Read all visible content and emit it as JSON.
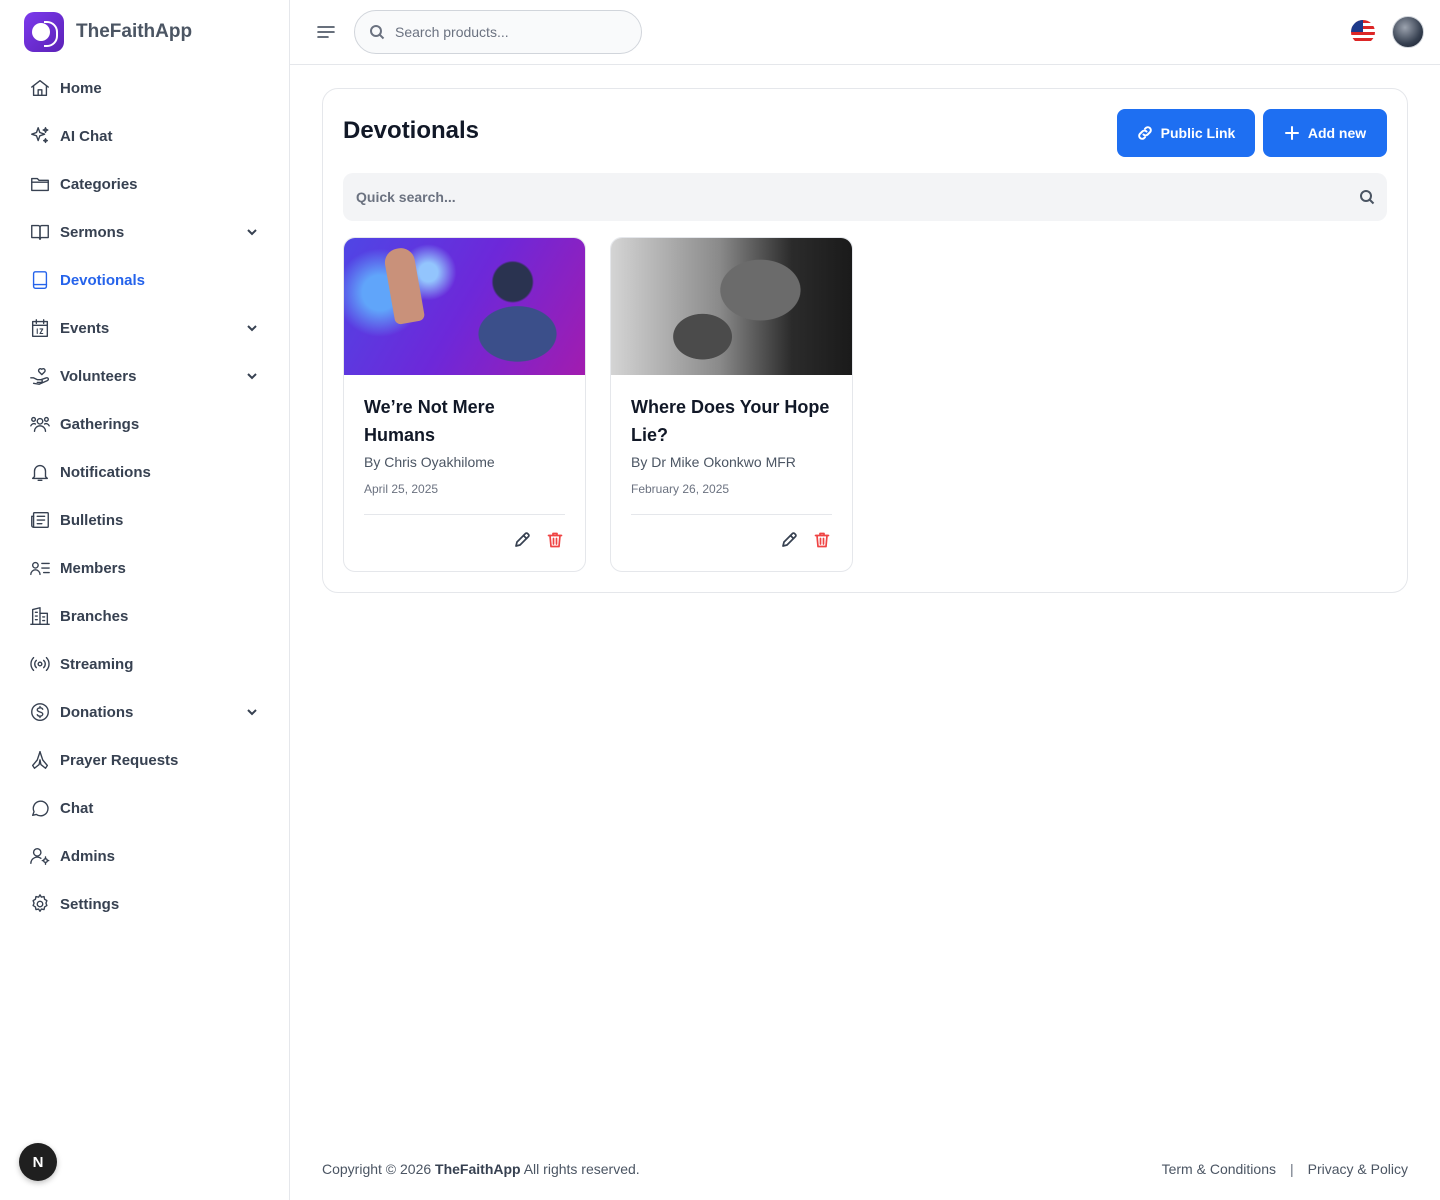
{
  "brand": {
    "name": "TheFaithApp"
  },
  "sidebar": {
    "items": [
      {
        "label": "Home",
        "icon": "home-icon",
        "has_chevron": false
      },
      {
        "label": "AI Chat",
        "icon": "sparkle-icon",
        "has_chevron": false
      },
      {
        "label": "Categories",
        "icon": "folder-icon",
        "has_chevron": false
      },
      {
        "label": "Sermons",
        "icon": "book-icon",
        "has_chevron": true
      },
      {
        "label": "Devotionals",
        "icon": "devotional-book-icon",
        "has_chevron": false,
        "active": true
      },
      {
        "label": "Events",
        "icon": "calendar-icon",
        "has_chevron": true
      },
      {
        "label": "Volunteers",
        "icon": "hand-heart-icon",
        "has_chevron": true
      },
      {
        "label": "Gatherings",
        "icon": "group-icon",
        "has_chevron": false
      },
      {
        "label": "Notifications",
        "icon": "bell-icon",
        "has_chevron": false
      },
      {
        "label": "Bulletins",
        "icon": "newspaper-icon",
        "has_chevron": false
      },
      {
        "label": "Members",
        "icon": "member-list-icon",
        "has_chevron": false
      },
      {
        "label": "Branches",
        "icon": "building-icon",
        "has_chevron": false
      },
      {
        "label": "Streaming",
        "icon": "broadcast-icon",
        "has_chevron": false
      },
      {
        "label": "Donations",
        "icon": "dollar-circle-icon",
        "has_chevron": true
      },
      {
        "label": "Prayer Requests",
        "icon": "praying-hands-icon",
        "has_chevron": false
      },
      {
        "label": "Chat",
        "icon": "chat-bubble-icon",
        "has_chevron": false
      },
      {
        "label": "Admins",
        "icon": "user-gear-icon",
        "has_chevron": false
      },
      {
        "label": "Settings",
        "icon": "gear-icon",
        "has_chevron": false
      }
    ],
    "dev_badge": "N"
  },
  "header": {
    "search_placeholder": "Search products..."
  },
  "main": {
    "title": "Devotionals",
    "public_link_label": "Public Link",
    "add_new_label": "Add new",
    "quick_search_placeholder": "Quick search...",
    "cards": [
      {
        "title": "We’re Not Mere Humans",
        "author": "By Chris Oyakhilome",
        "date": "April 25, 2025"
      },
      {
        "title": "Where Does Your Hope Lie?",
        "author": "By Dr Mike Okonkwo MFR",
        "date": "February 26, 2025"
      }
    ]
  },
  "footer": {
    "copyright_prefix": "Copyright © 2026",
    "copyright_brand": "TheFaithApp",
    "copyright_suffix": "All rights reserved.",
    "terms_label": "Term & Conditions",
    "separator": "|",
    "privacy_label": "Privacy & Policy"
  },
  "colors": {
    "accent": "#1e6ff2",
    "active_nav": "#2563eb",
    "danger": "#ef4444",
    "brand_purple": "#7c3aed"
  }
}
